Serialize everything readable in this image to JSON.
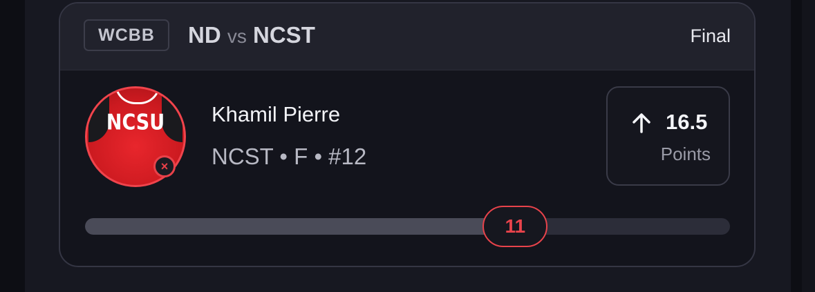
{
  "game": {
    "league": "WCBB",
    "home": "ND",
    "vs": "vs",
    "away": "NCST",
    "status": "Final"
  },
  "player": {
    "avatar_text": "NCSU",
    "name": "Khamil Pierre",
    "meta": "NCST • F • #12",
    "status_icon": "close-icon"
  },
  "line": {
    "direction": "over",
    "arrow_icon": "arrow-up-icon",
    "value": "16.5",
    "stat": "Points"
  },
  "progress": {
    "current": "11",
    "fraction": 0.667
  },
  "colors": {
    "accent_red": "#e8434b",
    "team_red": "#cc1a20"
  }
}
